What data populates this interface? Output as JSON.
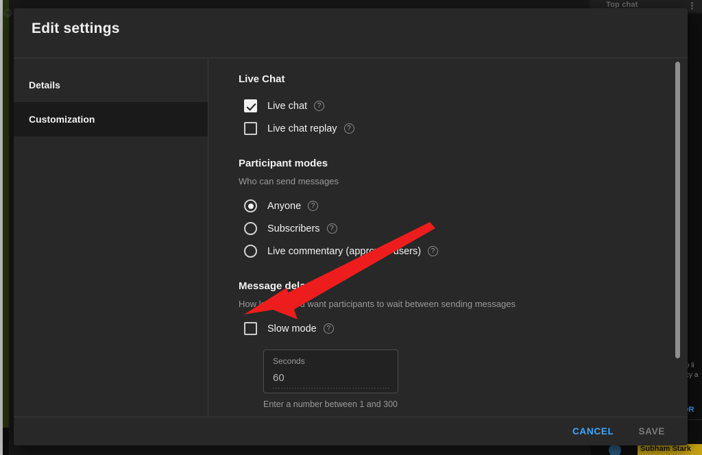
{
  "background": {
    "top_chat_label": "Top chat",
    "chat_line_1": "o li",
    "chat_line_2": "cy a",
    "show_more_label": "OR",
    "author_badge": "Subham Stark",
    "ghost_glyph": "☺"
  },
  "dialog": {
    "title": "Edit settings",
    "sidebar": {
      "items": [
        {
          "label": "Details",
          "active": false
        },
        {
          "label": "Customization",
          "active": true
        }
      ]
    },
    "sections": {
      "live_chat": {
        "title": "Live Chat",
        "options": [
          {
            "label": "Live chat",
            "checked": true,
            "help": "?"
          },
          {
            "label": "Live chat replay",
            "checked": false,
            "help": "?"
          }
        ]
      },
      "participant_modes": {
        "title": "Participant modes",
        "subtitle": "Who can send messages",
        "options": [
          {
            "label": "Anyone",
            "selected": true,
            "help": "?"
          },
          {
            "label": "Subscribers",
            "selected": false,
            "help": "?"
          },
          {
            "label": "Live commentary (approved users)",
            "selected": false,
            "help": "?"
          }
        ]
      },
      "message_delay": {
        "title": "Message delay",
        "subtitle": "How long do you want participants to wait between sending messages",
        "slow_mode": {
          "label": "Slow mode",
          "checked": false,
          "help": "?"
        },
        "seconds_field": {
          "label": "Seconds",
          "value": "60",
          "helper": "Enter a number between 1 and 300"
        }
      }
    },
    "footer": {
      "cancel_label": "CANCEL",
      "save_label": "SAVE"
    }
  },
  "colors": {
    "accent_link": "#3ea6ff",
    "dialog_surface": "#282828",
    "sidebar_active": "#1a1a1a",
    "annotation_arrow": "#ee1d1d",
    "badge": "#c8a415"
  }
}
